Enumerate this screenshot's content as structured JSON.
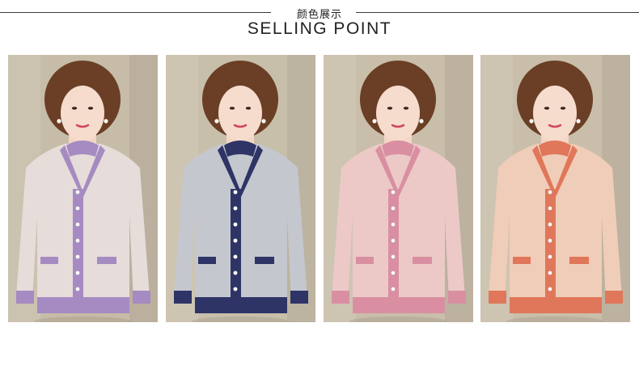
{
  "header": {
    "title_cn": "颜色展示",
    "title_en": "SELLING POINT"
  },
  "products": [
    {
      "color_name": "lavender",
      "body": "#e6dcd9",
      "trim": "#a58bc2",
      "bg": "#c7bca7"
    },
    {
      "color_name": "navy",
      "body": "#c4c7cd",
      "trim": "#2e3466",
      "bg": "#c8bfaa"
    },
    {
      "color_name": "pink",
      "body": "#ecc9c6",
      "trim": "#d98fa1",
      "bg": "#c9beaa"
    },
    {
      "color_name": "coral",
      "body": "#f0cdb8",
      "trim": "#e0775a",
      "bg": "#c9beaa"
    }
  ]
}
